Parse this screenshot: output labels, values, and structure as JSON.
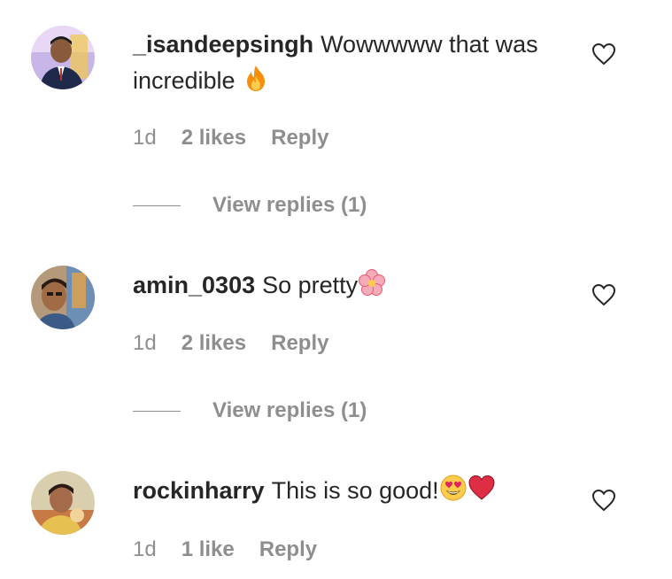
{
  "comments": [
    {
      "username": "_isandeepsingh",
      "text": "Wowwwww that was incredible",
      "emoji": "fire-emoji",
      "time": "1d",
      "likes": "2 likes",
      "reply": "Reply",
      "view_replies": "View replies (1)"
    },
    {
      "username": "amin_0303",
      "text": "So pretty",
      "emoji": "cherry-blossom-emoji",
      "time": "1d",
      "likes": "2 likes",
      "reply": "Reply",
      "view_replies": "View replies (1)"
    },
    {
      "username": "rockinharry",
      "text": "This is so good!",
      "emoji": "heart-eyes-emoji red-heart-emoji",
      "time": "1d",
      "likes": "1 like",
      "reply": "Reply"
    }
  ],
  "colors": {
    "text": "#262626",
    "secondary": "#8e8e8e",
    "background": "#ffffff"
  }
}
